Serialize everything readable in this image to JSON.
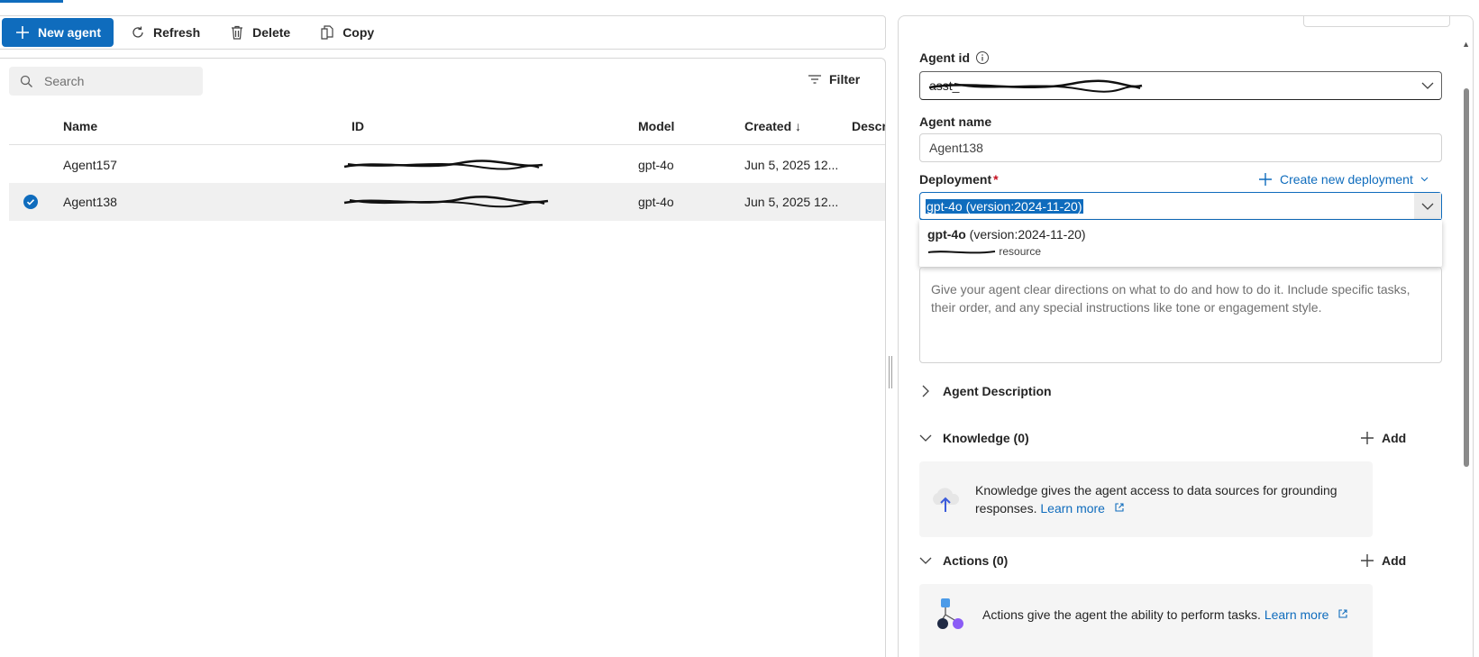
{
  "toolbar": {
    "new_agent": "New agent",
    "refresh": "Refresh",
    "delete": "Delete",
    "copy": "Copy"
  },
  "list": {
    "search_placeholder": "Search",
    "filter_label": "Filter",
    "columns": [
      "Name",
      "ID",
      "Model",
      "Created ↓",
      "Descr"
    ],
    "rows": [
      {
        "name": "Agent157",
        "id": "asst_...",
        "model": "gpt-4o",
        "created": "Jun 5, 2025 12...",
        "selected": false
      },
      {
        "name": "Agent138",
        "id": "asst_...",
        "model": "gpt-4o",
        "created": "Jun 5, 2025 12...",
        "selected": true
      }
    ]
  },
  "detail": {
    "agent_id_label": "Agent id",
    "agent_id_value": "asst_",
    "agent_name_label": "Agent name",
    "agent_name_value": "Agent138",
    "deployment_label": "Deployment",
    "required_mark": "*",
    "create_deployment": "Create new deployment",
    "deployment_value": "gpt-4o (version:2024-11-20)",
    "dropdown_option": {
      "model": "gpt-4o",
      "version": " (version:2024-11-20)",
      "resource_suffix": "resource"
    },
    "instructions_placeholder": "Give your agent clear directions on what to do and how to do it. Include specific tasks, their order, and any special instructions like tone or engagement style.",
    "agent_description": "Agent Description",
    "knowledge_title": "Knowledge (0)",
    "knowledge_text": "Knowledge gives the agent access to data sources for grounding responses.",
    "actions_title": "Actions (0)",
    "actions_text": "Actions give the agent the ability to perform tasks.",
    "learn_more": "Learn more",
    "add_label": "Add"
  },
  "colors": {
    "accent": "#0f6cbd",
    "selected_row": "#f0f0f0"
  }
}
